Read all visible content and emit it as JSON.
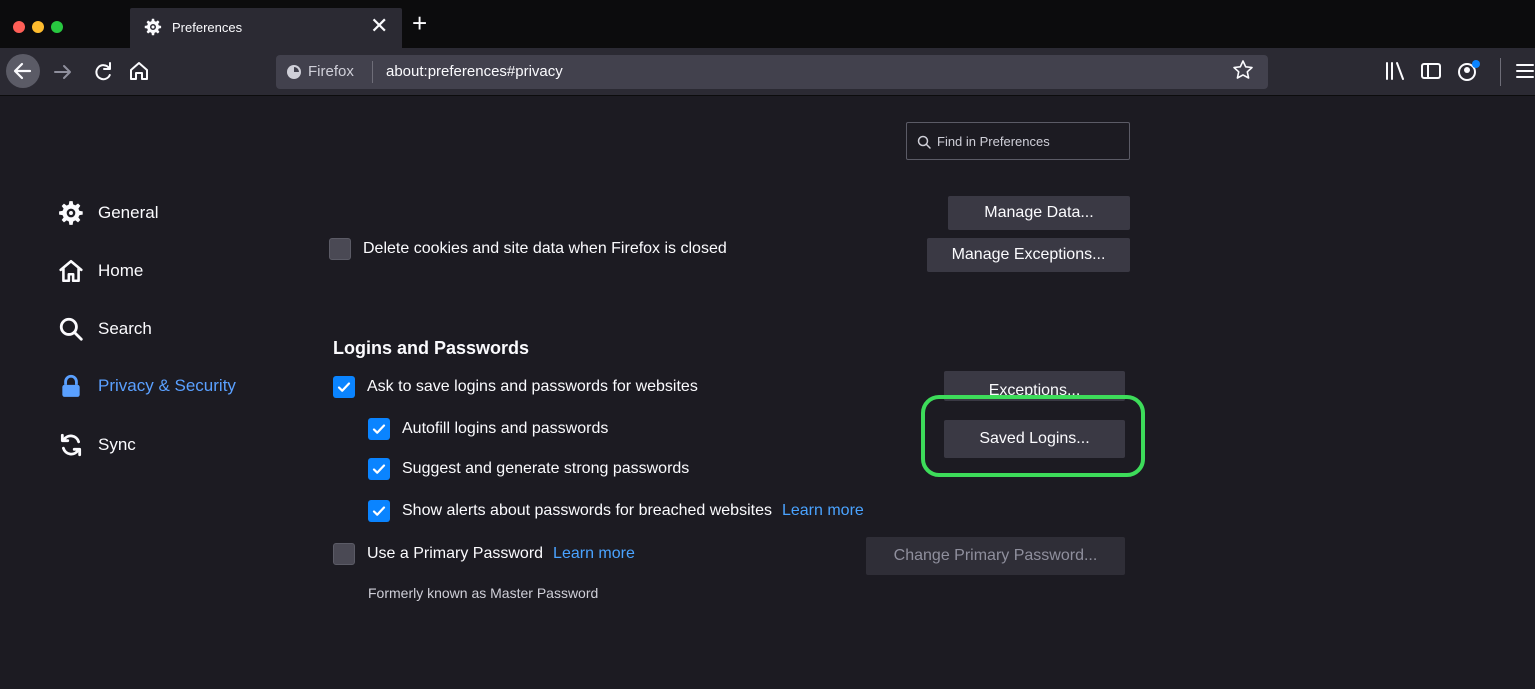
{
  "tab": {
    "title": "Preferences"
  },
  "urlbar": {
    "identity": "Firefox",
    "url": "about:preferences#privacy"
  },
  "search": {
    "placeholder": "Find in Preferences"
  },
  "sidebar": {
    "items": [
      {
        "label": "General",
        "icon": "gear-icon"
      },
      {
        "label": "Home",
        "icon": "home-icon"
      },
      {
        "label": "Search",
        "icon": "search-icon"
      },
      {
        "label": "Privacy & Security",
        "icon": "lock-icon",
        "selected": true
      },
      {
        "label": "Sync",
        "icon": "sync-icon"
      }
    ]
  },
  "cookies": {
    "manage_data": "Manage Data...",
    "delete_on_close": {
      "label": "Delete cookies and site data when Firefox is closed",
      "checked": false
    },
    "manage_exceptions": "Manage Exceptions..."
  },
  "logins": {
    "title": "Logins and Passwords",
    "ask_to_save": {
      "label": "Ask to save logins and passwords for websites",
      "checked": true
    },
    "autofill": {
      "label": "Autofill logins and passwords",
      "checked": true
    },
    "suggest": {
      "label": "Suggest and generate strong passwords",
      "checked": true
    },
    "breach_alerts": {
      "label": "Show alerts about passwords for breached websites",
      "checked": true,
      "link": "Learn more"
    },
    "primary_password": {
      "label": "Use a Primary Password",
      "checked": false,
      "link": "Learn more"
    },
    "formerly": "Formerly known as Master Password",
    "exceptions_button": "Exceptions...",
    "saved_logins_button": "Saved Logins...",
    "change_primary_button": "Change Primary Password..."
  },
  "colors": {
    "accent": "#0a84ff",
    "link": "#4aa3ff",
    "highlight": "#3ddc5a",
    "background": "#1c1b22"
  }
}
